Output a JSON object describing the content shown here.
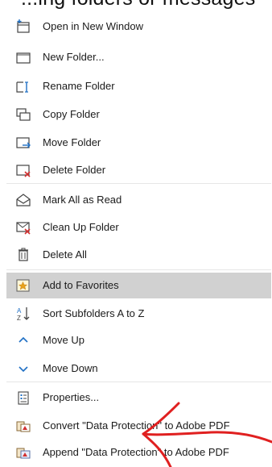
{
  "header_fragment": "...ing folders or messages",
  "menu": {
    "items": [
      {
        "id": "open-new-window",
        "label": "Open in New Window",
        "icon": "open-window-icon"
      },
      {
        "id": "new-folder",
        "label": "New Folder...",
        "icon": "folder-icon"
      },
      {
        "id": "rename-folder",
        "label": "Rename Folder",
        "icon": "rename-folder-icon"
      },
      {
        "id": "copy-folder",
        "label": "Copy Folder",
        "icon": "copy-folder-icon"
      },
      {
        "id": "move-folder",
        "label": "Move Folder",
        "icon": "move-folder-icon"
      },
      {
        "id": "delete-folder",
        "label": "Delete Folder",
        "icon": "delete-folder-icon"
      },
      {
        "id": "mark-all-read",
        "label": "Mark All as Read",
        "icon": "envelope-open-icon"
      },
      {
        "id": "clean-up-folder",
        "label": "Clean Up Folder",
        "icon": "clean-up-icon"
      },
      {
        "id": "delete-all",
        "label": "Delete All",
        "icon": "trash-icon"
      },
      {
        "id": "add-to-favorites",
        "label": "Add to Favorites",
        "icon": "star-icon",
        "highlighted": true
      },
      {
        "id": "sort-subfolders",
        "label": "Sort Subfolders A to Z",
        "icon": "sort-az-icon"
      },
      {
        "id": "move-up",
        "label": "Move Up",
        "icon": "chevron-up-icon"
      },
      {
        "id": "move-down",
        "label": "Move Down",
        "icon": "chevron-down-icon"
      },
      {
        "id": "properties",
        "label": "Properties...",
        "icon": "properties-icon"
      },
      {
        "id": "convert-pdf",
        "label": "Convert \"Data Protection\" to Adobe PDF",
        "icon": "adobe-pdf-icon"
      },
      {
        "id": "append-pdf",
        "label": "Append \"Data Protection\" to Adobe PDF",
        "icon": "adobe-pdf-append-icon"
      }
    ]
  },
  "colors": {
    "highlight": "#d1d1d1",
    "accent_blue": "#1e6fc4",
    "delete_red": "#d23030",
    "annotation_red": "#e02020"
  }
}
